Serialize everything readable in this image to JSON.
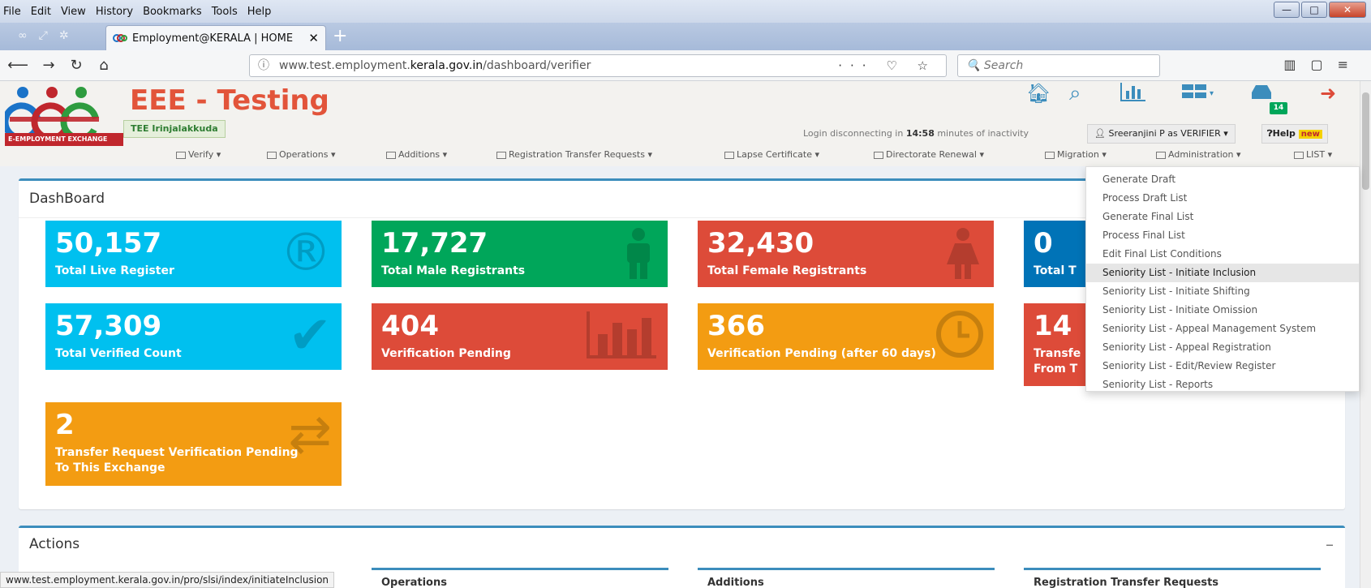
{
  "browser": {
    "menu": [
      "File",
      "Edit",
      "View",
      "History",
      "Bookmarks",
      "Tools",
      "Help"
    ],
    "tab_title": "Employment@KERALA | HOME",
    "url_prefix": "www.test.employment.",
    "url_host": "kerala.gov.in",
    "url_path": "/dashboard/verifier",
    "url_actions": "··· ♡ ☆",
    "search_placeholder": "Search",
    "status_url": "www.test.employment.kerala.gov.in/pro/slsi/index/initiateInclusion"
  },
  "header": {
    "brand": "EEE - Testing",
    "logo_text": "E-EMPLOYMENT EXCHANGE",
    "exchange": "TEE Irinjalakkuda",
    "mail_count": "14",
    "login_prefix": "Login disconnecting in ",
    "login_time": "14:58",
    "login_suffix": " minutes of inactivity",
    "user": "Sreeranjini P as VERIFIER ▾",
    "help": "Help",
    "help_badge": "new"
  },
  "menu": [
    {
      "label": "Verify ▾"
    },
    {
      "label": "Operations ▾"
    },
    {
      "label": "Additions ▾"
    },
    {
      "label": "Registration Transfer Requests ▾"
    },
    {
      "label": "Lapse Certificate ▾"
    },
    {
      "label": "Directorate Renewal ▾"
    },
    {
      "label": "Migration ▾"
    },
    {
      "label": "Administration ▾"
    },
    {
      "label": "LIST ▾"
    }
  ],
  "dashboard": {
    "title": "DashBoard",
    "tiles": [
      {
        "num": "50,157",
        "label": "Total Live Register",
        "color": "#00c0ef",
        "icon": "registered-icon"
      },
      {
        "num": "17,727",
        "label": "Total Male Registrants",
        "color": "#00a65a",
        "icon": "male-icon"
      },
      {
        "num": "32,430",
        "label": "Total Female Registrants",
        "color": "#dd4b39",
        "icon": "female-icon"
      },
      {
        "num": "0",
        "label": "Total T",
        "color": "#0073b7",
        "icon": "none"
      },
      {
        "num": "57,309",
        "label": "Total Verified Count",
        "color": "#00c0ef",
        "icon": "check-icon"
      },
      {
        "num": "404",
        "label": "Verification Pending",
        "color": "#dd4b39",
        "icon": "bar-chart-icon"
      },
      {
        "num": "366",
        "label": "Verification Pending (after 60 days)",
        "color": "#f39c12",
        "icon": "clock-icon"
      },
      {
        "num": "14",
        "label_line1": "Transfe",
        "label_line2": "From T",
        "color": "#dd4b39",
        "icon": "none"
      },
      {
        "num": "2",
        "label_line1": "Transfer Request Verification Pending",
        "label_line2": "To This Exchange",
        "color": "#f39c12",
        "icon": "exchange-arrows-icon"
      }
    ]
  },
  "actions": {
    "title": "Actions",
    "collapse": "–",
    "boxes": [
      "Operations",
      "Additions",
      "Registration Transfer Requests"
    ]
  },
  "dropdown": {
    "items": [
      "Generate Draft",
      "Process Draft List",
      "Generate Final List",
      "Process Final List",
      "Edit Final List Conditions",
      "Seniority List - Initiate Inclusion",
      "Seniority List - Initiate Shifting",
      "Seniority List - Initiate Omission",
      "Seniority List - Appeal Management System",
      "Seniority List - Appeal Registration",
      "Seniority List - Edit/Review Register",
      "Seniority List - Reports"
    ],
    "active_index": 5
  }
}
